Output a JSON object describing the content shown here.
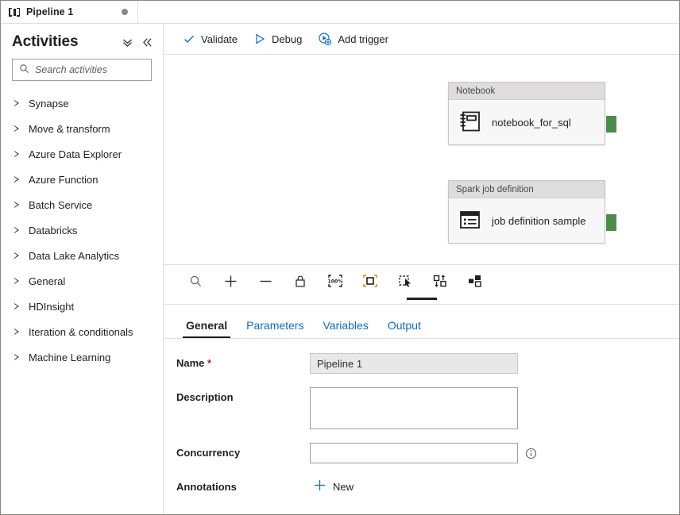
{
  "window": {
    "tab": {
      "label": "Pipeline 1",
      "icon": "pipeline-icon",
      "dirty_indicator": "unsaved-changes-dot"
    }
  },
  "sidebar": {
    "title": "Activities",
    "collapse_all_icon": "double-chevron-down-icon",
    "collapse_panel_icon": "double-chevron-left-icon",
    "search": {
      "placeholder": "Search activities",
      "value": "",
      "icon": "search-icon"
    },
    "categories": [
      {
        "label": "Synapse"
      },
      {
        "label": "Move & transform"
      },
      {
        "label": "Azure Data Explorer"
      },
      {
        "label": "Azure Function"
      },
      {
        "label": "Batch Service"
      },
      {
        "label": "Databricks"
      },
      {
        "label": "Data Lake Analytics"
      },
      {
        "label": "General"
      },
      {
        "label": "HDInsight"
      },
      {
        "label": "Iteration & conditionals"
      },
      {
        "label": "Machine Learning"
      }
    ]
  },
  "toolbar": {
    "validate_label": "Validate",
    "validate_icon": "checkmark-icon",
    "debug_label": "Debug",
    "debug_icon": "play-triangle-icon",
    "add_trigger_label": "Add trigger",
    "add_trigger_icon": "trigger-add-icon"
  },
  "canvas": {
    "nodes": [
      {
        "type": "Notebook",
        "name": "notebook_for_sql",
        "icon": "notebook-icon",
        "port": "output-port"
      },
      {
        "type": "Spark job definition",
        "name": "job definition sample",
        "icon": "spark-job-definition-icon",
        "port": "output-port"
      }
    ],
    "tools": [
      {
        "name": "zoom-search-icon"
      },
      {
        "name": "zoom-in-icon"
      },
      {
        "name": "zoom-out-icon"
      },
      {
        "name": "lock-icon"
      },
      {
        "name": "zoom-100-percent-icon",
        "label": "100%"
      },
      {
        "name": "fit-to-screen-icon"
      },
      {
        "name": "marquee-select-icon"
      },
      {
        "name": "auto-align-icon"
      },
      {
        "name": "auto-layout-icon"
      }
    ]
  },
  "detail": {
    "tabs": [
      {
        "label": "General",
        "active": true
      },
      {
        "label": "Parameters",
        "active": false
      },
      {
        "label": "Variables",
        "active": false
      },
      {
        "label": "Output",
        "active": false
      }
    ],
    "fields": {
      "name_label": "Name",
      "name_required_mark": "*",
      "name_value": "Pipeline 1",
      "description_label": "Description",
      "description_value": "",
      "concurrency_label": "Concurrency",
      "concurrency_value": "",
      "concurrency_info_icon": "info-circle-icon",
      "annotations_label": "Annotations",
      "annotations_new_label": "New",
      "annotations_new_icon": "plus-icon"
    }
  },
  "colors": {
    "accent_blue": "#0f6cbd",
    "port_green": "#4c8c4a",
    "required_red": "#a4262c",
    "node_header_grey": "#dedcdc"
  }
}
